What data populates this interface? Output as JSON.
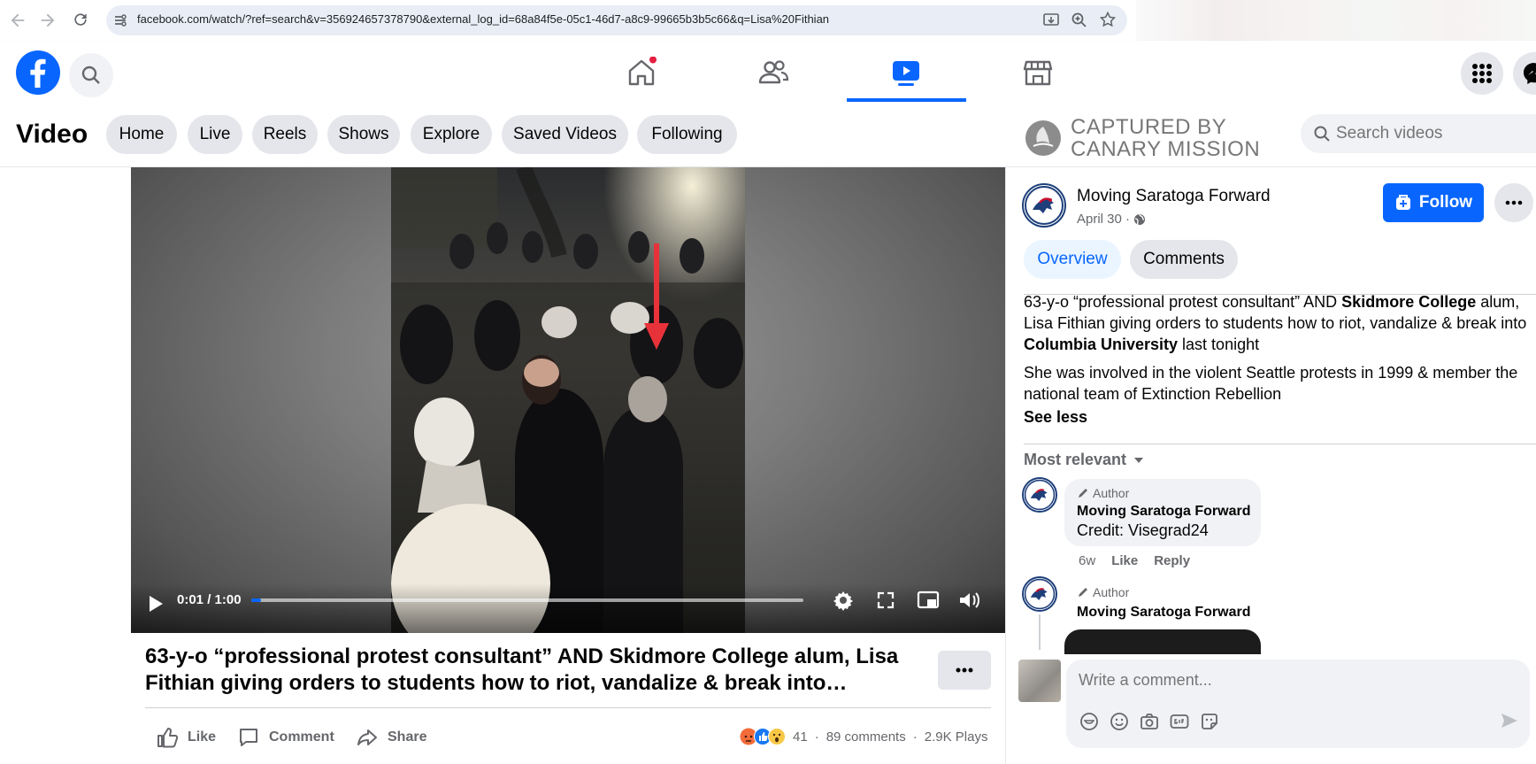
{
  "browser": {
    "url": "facebook.com/watch/?ref=search&v=356924657378790&external_log_id=68a84f5e-05c1-46d7-a8c9-99665b3b5c66&q=Lisa%20Fithian"
  },
  "topnav": {
    "tabs": [
      {
        "name": "home",
        "icon": "home-icon",
        "notification_dot": true
      },
      {
        "name": "friends",
        "icon": "friends-icon"
      },
      {
        "name": "watch",
        "icon": "video-icon",
        "active": true
      },
      {
        "name": "marketplace",
        "icon": "marketplace-icon"
      }
    ],
    "accent_color": "#0866ff"
  },
  "video_header": {
    "title": "Video",
    "pills": [
      "Home",
      "Live",
      "Reels",
      "Shows",
      "Explore",
      "Saved Videos",
      "Following"
    ],
    "watermark": "CAPTURED BY\nCANARY MISSION",
    "search_placeholder": "Search videos"
  },
  "player": {
    "time": "0:01 / 1:00",
    "progress_fraction": 0.017
  },
  "video_meta": {
    "title": "63-y-o “professional protest consultant” AND Skidmore College alum, Lisa Fithian giving orders to students how to riot, vandalize & break into Columbia University last tonight",
    "actions": {
      "like": "Like",
      "comment": "Comment",
      "share": "Share"
    },
    "reaction_count": "41",
    "comments_count": "89 comments",
    "plays": "2.9K Plays",
    "separator": "·"
  },
  "post": {
    "page_name": "Moving Saratoga Forward",
    "date": "April 30 ·",
    "follow_label": "Follow",
    "tabs": {
      "overview": "Overview",
      "comments": "Comments"
    },
    "description": {
      "p1_a": "63-y-o “professional protest consultant” AND ",
      "p1_b": "Skidmore College",
      "p1_c": " alum, Lisa Fithian giving orders to students how to riot, vandalize & break into ",
      "p1_d": "Columbia University",
      "p1_e": " last tonight",
      "p2": "She was involved in the violent Seattle protests in 1999 & member the national team of Extinction Rebellion",
      "see_less": "See less"
    },
    "sort_label": "Most relevant",
    "comments": [
      {
        "badge": "Author",
        "name": "Moving Saratoga Forward",
        "text": "Credit: Visegrad24",
        "age": "6w",
        "like": "Like",
        "reply": "Reply"
      },
      {
        "badge": "Author",
        "name": "Moving Saratoga Forward"
      }
    ],
    "comment_placeholder": "Write a comment..."
  }
}
